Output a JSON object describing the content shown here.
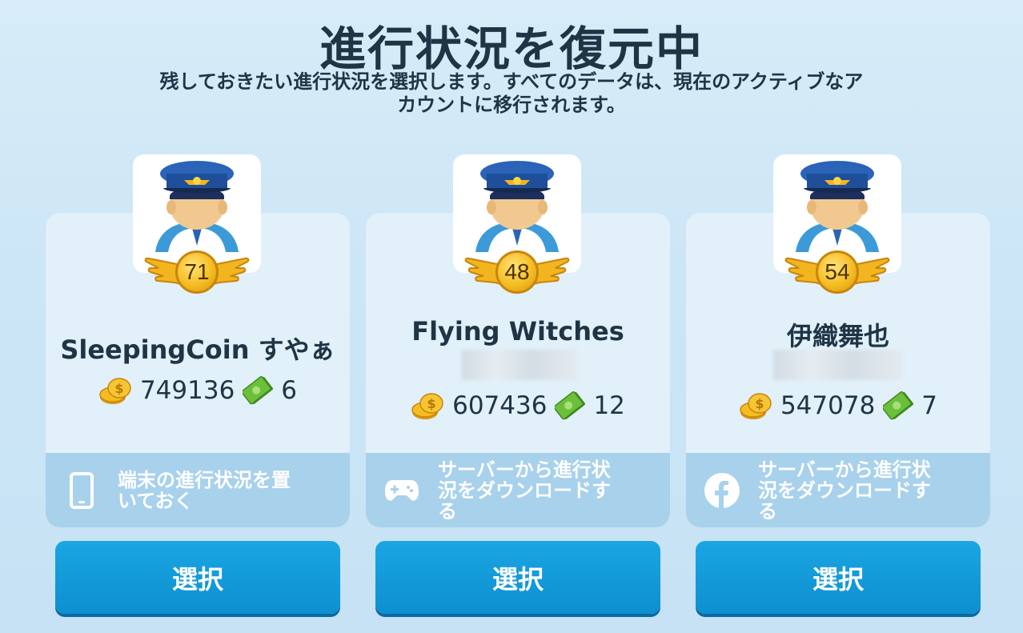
{
  "header": {
    "title": "進行状況を復元中",
    "subtitle_line1": "残しておきたい進行状況を選択します。すべてのデータは、現在のアクティブなア",
    "subtitle_line2": "カウントに移行されます。"
  },
  "cards": [
    {
      "level": "71",
      "name": "SleepingCoin すやぁ",
      "coins": "749136",
      "cash": "6",
      "source_icon": "phone-icon",
      "source_label_1": "端末の進行状況を置",
      "source_label_2": "いておく",
      "source_label_3": "",
      "button_label": "選択"
    },
    {
      "level": "48",
      "name": "Flying Witches",
      "coins": "607436",
      "cash": "12",
      "source_icon": "gamepad-icon",
      "source_label_1": "サーバーから進行状",
      "source_label_2": "況をダウンロードす",
      "source_label_3": "る",
      "button_label": "選択"
    },
    {
      "level": "54",
      "name": "伊織舞也",
      "coins": "547078",
      "cash": "7",
      "source_icon": "facebook-icon",
      "source_label_1": "サーバーから進行状",
      "source_label_2": "況をダウンロードす",
      "source_label_3": "る",
      "button_label": "選択"
    }
  ],
  "colors": {
    "button": "#1aa6e2",
    "card_bg": "#e1f0f9",
    "source_band": "#a8d1ec",
    "coin_gold": "#f5bd22",
    "cash_green": "#5aa52e"
  }
}
